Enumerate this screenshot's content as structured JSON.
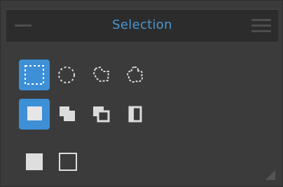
{
  "panel": {
    "title": "Selection",
    "accent_color": "#3d8fd6",
    "title_color": "#4a98d2",
    "collapse_icon": "minus-icon",
    "menu_icon": "hamburger-menu-icon",
    "resize_icon": "resize-grip-icon"
  },
  "tools": {
    "shape_row": [
      {
        "name": "rectangle-select",
        "icon": "rectangle-selection-icon",
        "active": true
      },
      {
        "name": "ellipse-select",
        "icon": "ellipse-selection-icon",
        "active": false
      },
      {
        "name": "polygon-lasso-select",
        "icon": "polygon-lasso-icon",
        "active": false
      },
      {
        "name": "freehand-lasso-select",
        "icon": "freehand-lasso-icon",
        "active": false
      }
    ],
    "mode_row": [
      {
        "name": "new-selection",
        "icon": "new-selection-icon",
        "active": true
      },
      {
        "name": "add-to-selection",
        "icon": "add-to-selection-icon",
        "active": false
      },
      {
        "name": "subtract-from-selection",
        "icon": "subtract-selection-icon",
        "active": false
      },
      {
        "name": "intersect-selection",
        "icon": "intersect-selection-icon",
        "active": false
      }
    ],
    "fill_row": [
      {
        "name": "fill-selection",
        "icon": "filled-square-icon",
        "active": false
      },
      {
        "name": "clear-selection",
        "icon": "outline-square-icon",
        "active": false
      }
    ]
  }
}
